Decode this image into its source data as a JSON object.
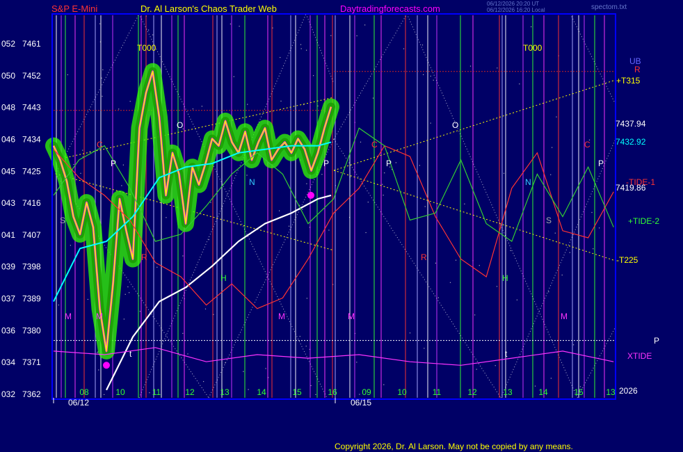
{
  "header": {
    "instrument": "S&P E-Mini",
    "site_title": "Dr. Al Larson's Chaos Trader Web",
    "site_link": "Daytradingforecasts.com",
    "timestamps": [
      "06/12/2026 20:20 UT",
      "06/12/2026 16:20 Local"
    ],
    "file_name": "spectom.txt"
  },
  "footer": {
    "copyright": "Copyright 2026, Dr. Al Larson. May not be copied by any means."
  },
  "colors": {
    "background": "#000066",
    "plot_border": "#0000ff",
    "price": "#ffff00",
    "bands": "#33ff00",
    "magenta": "#ff00ff",
    "cyan_avg": "#00ffff",
    "white_avg": "#ffffff",
    "tide1": "#ff3333",
    "tide2": "#33cc33",
    "xtide": "#ff33ff",
    "grid": "#ffffff"
  },
  "chart_data": {
    "type": "line",
    "title": "S&P E-Mini",
    "y_axis": {
      "ticks": [
        {
          "code": "052",
          "price": 7461
        },
        {
          "code": "050",
          "price": 7452
        },
        {
          "code": "048",
          "price": 7443
        },
        {
          "code": "046",
          "price": 7434
        },
        {
          "code": "045",
          "price": 7425
        },
        {
          "code": "043",
          "price": 7416
        },
        {
          "code": "041",
          "price": 7407
        },
        {
          "code": "039",
          "price": 7398
        },
        {
          "code": "037",
          "price": 7389
        },
        {
          "code": "036",
          "price": 7380
        },
        {
          "code": "034",
          "price": 7371
        },
        {
          "code": "032",
          "price": 7362
        }
      ],
      "ylim": [
        7362,
        7461
      ]
    },
    "x_axis": {
      "hour_labels": [
        "08",
        "10",
        "11",
        "12",
        "13",
        "14",
        "15",
        "16",
        "09",
        "10",
        "11",
        "12",
        "13",
        "14",
        "15",
        "13"
      ],
      "date_labels": [
        "06/12",
        "06/15"
      ],
      "end_label": "2026"
    },
    "right_labels": {
      "ub": "UB",
      "r": "R",
      "t315": "+T315",
      "close_price": "7437.94",
      "avg_price": "7432.92",
      "tide1_label": "-TIDE-1",
      "tide1_value": "7419.86",
      "tide2_label": "+TIDE-2",
      "t225": "-T225",
      "p_marker": "P",
      "xtide_label": "XTIDE"
    },
    "markers": [
      "T000",
      "T000",
      "O",
      "O",
      "P",
      "P",
      "P",
      "P",
      "C",
      "C",
      "C",
      "N",
      "N",
      "S",
      "S",
      "H",
      "H",
      "R",
      "R",
      "M",
      "M",
      "M",
      "M",
      "t",
      "t",
      "M"
    ],
    "series": [
      {
        "name": "S&P E-Mini",
        "x": [
          0,
          5,
          10,
          15,
          20,
          25,
          30,
          35,
          40,
          45,
          50,
          55,
          60,
          65,
          70,
          75,
          80,
          85,
          90,
          95,
          100,
          105,
          110,
          115,
          120,
          125,
          130,
          135,
          140,
          145,
          150,
          155,
          160,
          165,
          170,
          175,
          180,
          185,
          190,
          195,
          200,
          205,
          210
        ],
        "y": [
          7432,
          7428,
          7422,
          7412,
          7407,
          7416,
          7409,
          7386,
          7374,
          7393,
          7417,
          7408,
          7400,
          7437,
          7447,
          7453,
          7440,
          7418,
          7430,
          7424,
          7410,
          7426,
          7421,
          7427,
          7434,
          7432,
          7439,
          7433,
          7430,
          7436,
          7428,
          7433,
          7437,
          7428,
          7431,
          7433,
          7430,
          7434,
          7431,
          7425,
          7430,
          7437,
          7443
        ]
      },
      {
        "name": "Average",
        "x": [
          0,
          20,
          40,
          60,
          80,
          100,
          120,
          140,
          160,
          180,
          200,
          210
        ],
        "y": [
          7388,
          7403,
          7405,
          7412,
          7423,
          7426,
          7427,
          7430,
          7431,
          7432,
          7432,
          7433
        ]
      },
      {
        "name": "Long Average",
        "x": [
          40,
          60,
          80,
          100,
          120,
          140,
          160,
          180,
          200,
          210
        ],
        "y": [
          7363,
          7378,
          7388,
          7392,
          7398,
          7405,
          7410,
          7413,
          7417,
          7418
        ]
      },
      {
        "name": "TIDE-1",
        "x": [
          0,
          20,
          40,
          60,
          80,
          100,
          120,
          140,
          160,
          180,
          200,
          220,
          240,
          260,
          280,
          300,
          320,
          340,
          360,
          380,
          400,
          420,
          440
        ],
        "y": [
          7431,
          7423,
          7418,
          7411,
          7399,
          7395,
          7387,
          7393,
          7386,
          7389,
          7400,
          7413,
          7420,
          7432,
          7429,
          7412,
          7400,
          7395,
          7420,
          7430,
          7408,
          7406,
          7419
        ]
      },
      {
        "name": "TIDE-2",
        "x": [
          0,
          20,
          40,
          60,
          80,
          100,
          120,
          140,
          160,
          180,
          200,
          220,
          240,
          260,
          280,
          300,
          320,
          340,
          360,
          380,
          400,
          420,
          440
        ],
        "y": [
          7418,
          7428,
          7432,
          7420,
          7405,
          7407,
          7415,
          7424,
          7430,
          7424,
          7410,
          7417,
          7437,
          7432,
          7411,
          7413,
          7428,
          7410,
          7405,
          7424,
          7412,
          7426,
          7409
        ]
      },
      {
        "name": "XTIDE",
        "x": [
          0,
          40,
          80,
          120,
          160,
          200,
          240,
          280,
          320,
          360,
          400,
          440
        ],
        "y": [
          7374,
          7373,
          7375,
          7371,
          7373,
          7372,
          7373,
          7371,
          7370,
          7372,
          7374,
          7371
        ]
      }
    ],
    "horizontal_lines": [
      {
        "name": "dotted-white",
        "y": 7377
      },
      {
        "name": "dotted-red",
        "y": 7453
      },
      {
        "name": "dotted-red-low",
        "y": 7442
      }
    ],
    "grid": false,
    "legend": "none"
  }
}
